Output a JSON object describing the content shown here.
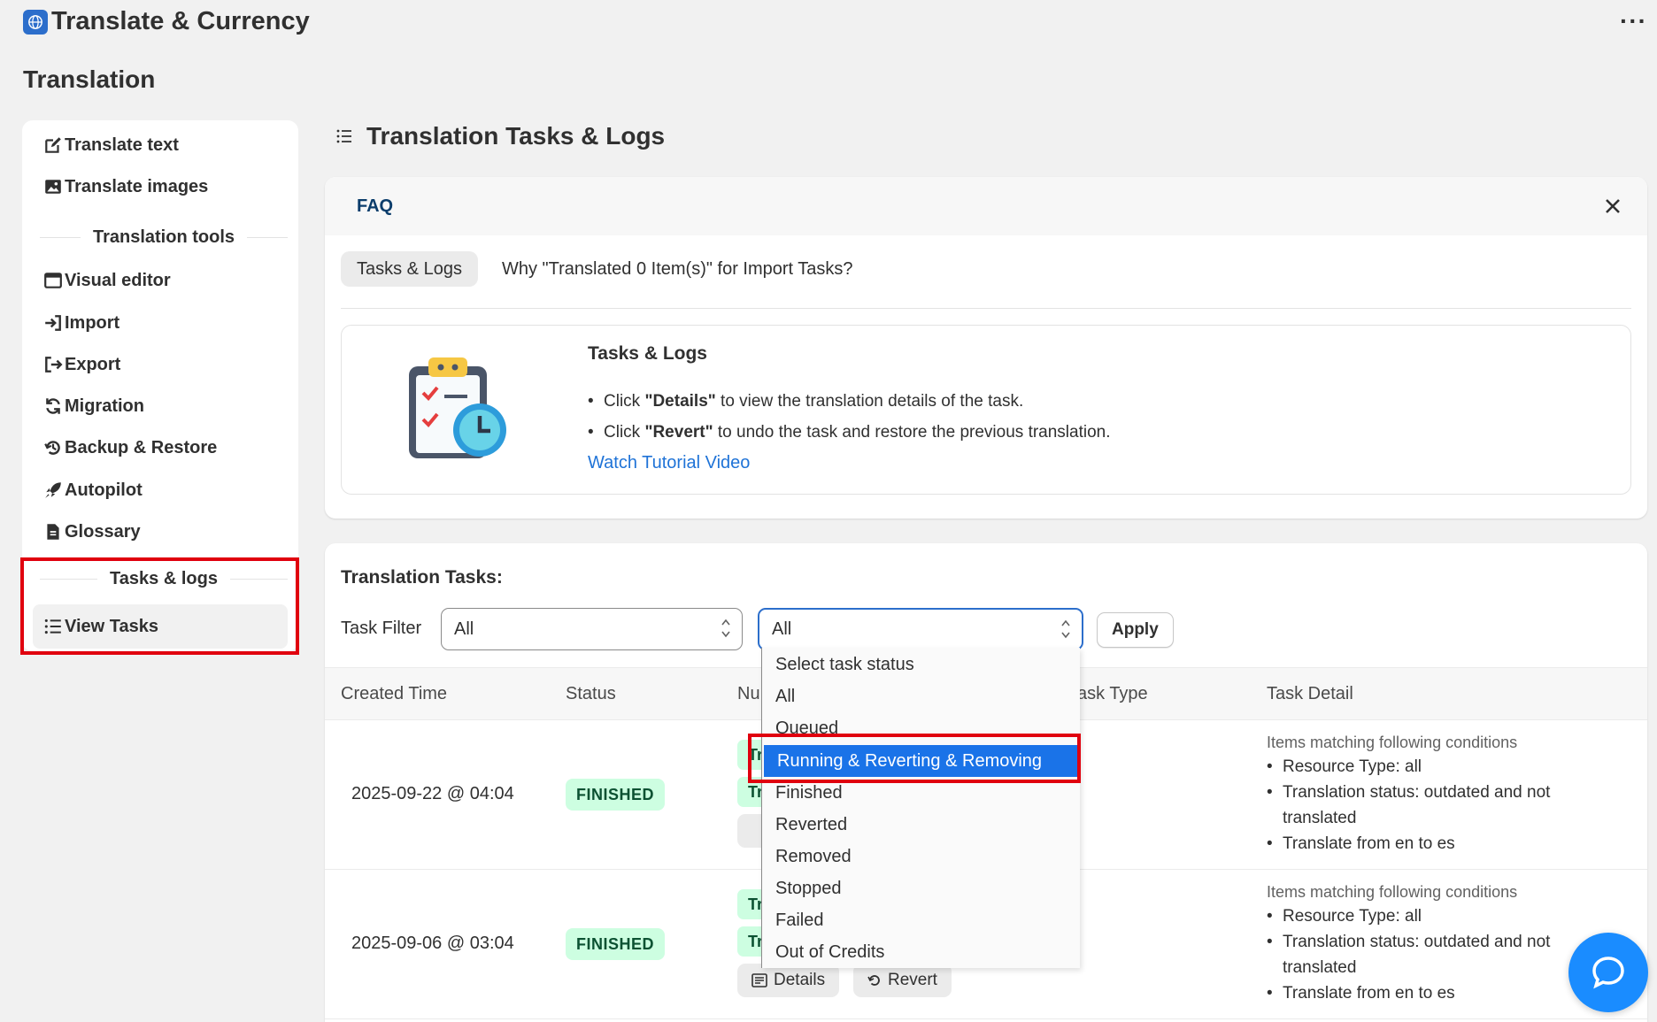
{
  "app": {
    "title": "Translate & Currency",
    "more_label": "···"
  },
  "page": {
    "title": "Translation"
  },
  "sidebar": {
    "items_top": [
      {
        "label": "Translate text",
        "icon": "edit-icon"
      },
      {
        "label": "Translate images",
        "icon": "image-icon"
      }
    ],
    "tools_heading": "Translation tools",
    "tools": [
      {
        "label": "Visual editor",
        "icon": "window-icon"
      },
      {
        "label": "Import",
        "icon": "import-icon"
      },
      {
        "label": "Export",
        "icon": "export-icon"
      },
      {
        "label": "Migration",
        "icon": "refresh-icon"
      },
      {
        "label": "Backup & Restore",
        "icon": "history-icon"
      },
      {
        "label": "Autopilot",
        "icon": "rocket-icon"
      },
      {
        "label": "Glossary",
        "icon": "document-icon"
      }
    ],
    "tasks_heading": "Tasks & logs",
    "view_tasks": {
      "label": "View Tasks",
      "icon": "list-icon"
    }
  },
  "main": {
    "title": "Translation Tasks & Logs"
  },
  "faq": {
    "label": "FAQ",
    "pill": "Tasks & Logs",
    "question": "Why \"Translated 0 Item(s)\" for Import Tasks?",
    "tip_title": "Tasks & Logs",
    "tips": [
      {
        "prefix": "Click ",
        "bold": "\"Details\"",
        "suffix": " to view the translation details of the task."
      },
      {
        "prefix": "Click ",
        "bold": "\"Revert\"",
        "suffix": " to undo the task and restore the previous translation."
      }
    ],
    "link": "Watch Tutorial Video"
  },
  "tasks": {
    "title": "Translation Tasks:",
    "filter_label": "Task Filter",
    "filter_type_value": "All",
    "filter_status_value": "All",
    "apply_label": "Apply",
    "columns": [
      "Created Time",
      "Status",
      "Nu",
      "ask Type",
      "Task Detail"
    ],
    "rows": [
      {
        "created": "2025-09-22 @ 04:04",
        "status": "FINISHED",
        "tags": [
          "Tr",
          "Tr"
        ],
        "detail_head": "Items matching following conditions",
        "details": [
          "Resource Type: all",
          "Translation status: outdated and not translated",
          "Translate from en to es"
        ]
      },
      {
        "created": "2025-09-06 @ 03:04",
        "status": "FINISHED",
        "tags": [
          "Tr",
          "Tr"
        ],
        "details_btn": "Details",
        "revert_btn": "Revert",
        "detail_head": "Items matching following conditions",
        "details": [
          "Resource Type: all",
          "Translation status: outdated and not translated",
          "Translate from en to es"
        ]
      }
    ]
  },
  "status_dropdown": {
    "options": [
      "Select task status",
      "All",
      "Queued",
      "Running & Reverting & Removing",
      "Finished",
      "Reverted",
      "Removed",
      "Stopped",
      "Failed",
      "Out of Credits"
    ],
    "selected": "Running & Reverting & Removing"
  },
  "colors": {
    "accent": "#2c6ecb",
    "highlight": "#e0000e",
    "success_bg": "#cdfee1",
    "selected_option": "#1a73e8"
  }
}
